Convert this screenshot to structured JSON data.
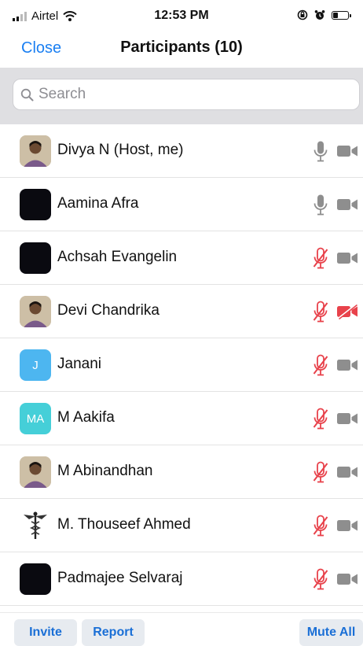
{
  "status_bar": {
    "carrier": "Airtel",
    "time": "12:53 PM"
  },
  "nav": {
    "close_label": "Close",
    "title": "Participants (10)"
  },
  "search": {
    "placeholder": "Search"
  },
  "participants": [
    {
      "name": "Divya N (Host, me)",
      "avatar": "photo",
      "muted": false,
      "video_off": false
    },
    {
      "name": "Aamina Afra",
      "avatar": "black",
      "muted": false,
      "video_off": false
    },
    {
      "name": "Achsah Evangelin",
      "avatar": "black",
      "muted": true,
      "video_off": false
    },
    {
      "name": "Devi Chandrika",
      "avatar": "photo",
      "muted": true,
      "video_off": true
    },
    {
      "name": "Janani",
      "avatar": "initial",
      "initials": "J",
      "avatar_color": "#4db6f0",
      "muted": true,
      "video_off": false
    },
    {
      "name": "M Aakifa",
      "avatar": "initial",
      "initials": "MA",
      "avatar_color": "#45cfd8",
      "muted": true,
      "video_off": false
    },
    {
      "name": "M Abinandhan",
      "avatar": "photo",
      "muted": true,
      "video_off": false
    },
    {
      "name": "M. Thouseef Ahmed",
      "avatar": "caduceus",
      "muted": true,
      "video_off": false
    },
    {
      "name": "Padmajee Selvaraj",
      "avatar": "black",
      "muted": true,
      "video_off": false
    }
  ],
  "bottom": {
    "invite_label": "Invite",
    "report_label": "Report",
    "mute_all_label": "Mute All"
  },
  "colors": {
    "accent": "#1a7ff2",
    "muted_red": "#e8424b",
    "icon_gray": "#8e8e8e"
  }
}
